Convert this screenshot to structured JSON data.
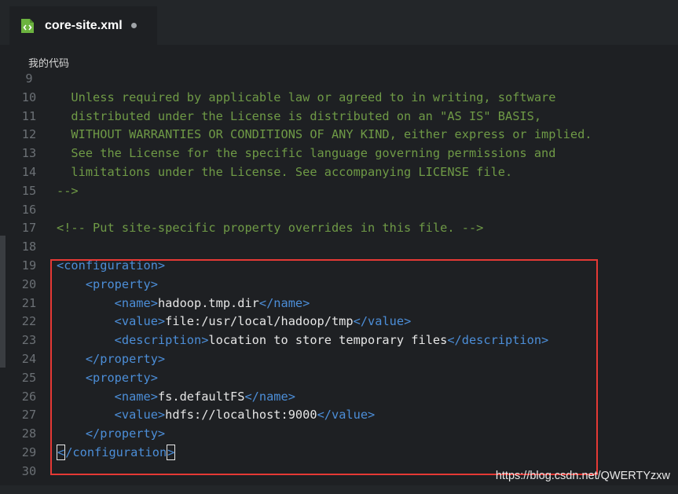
{
  "tab": {
    "filename": "core-site.xml",
    "icon": "xml-file-icon"
  },
  "panel": {
    "title": "我的代码"
  },
  "editor": {
    "lines": [
      {
        "n": "9",
        "segments": []
      },
      {
        "n": "10",
        "segments": [
          {
            "t": "  Unless required by applicable law or agreed to in writing, software",
            "c": "comment"
          }
        ]
      },
      {
        "n": "11",
        "segments": [
          {
            "t": "  distributed under the License is distributed on an \"AS IS\" BASIS,",
            "c": "comment"
          }
        ]
      },
      {
        "n": "12",
        "segments": [
          {
            "t": "  WITHOUT WARRANTIES OR CONDITIONS OF ANY KIND, either express or implied.",
            "c": "comment"
          }
        ]
      },
      {
        "n": "13",
        "segments": [
          {
            "t": "  See the License for the specific language governing permissions and",
            "c": "comment"
          }
        ]
      },
      {
        "n": "14",
        "segments": [
          {
            "t": "  limitations under the License. See accompanying LICENSE file.",
            "c": "comment"
          }
        ]
      },
      {
        "n": "15",
        "segments": [
          {
            "t": "-->",
            "c": "comment"
          }
        ]
      },
      {
        "n": "16",
        "segments": []
      },
      {
        "n": "17",
        "segments": [
          {
            "t": "<!-- Put site-specific property overrides in this file. -->",
            "c": "comment"
          }
        ]
      },
      {
        "n": "18",
        "segments": []
      },
      {
        "n": "19",
        "segments": [
          {
            "t": "<configuration>",
            "c": "tag"
          }
        ]
      },
      {
        "n": "20",
        "segments": [
          {
            "t": "    <property>",
            "c": "tag"
          }
        ]
      },
      {
        "n": "21",
        "segments": [
          {
            "t": "        <name>",
            "c": "tag"
          },
          {
            "t": "hadoop.tmp.dir",
            "c": "text"
          },
          {
            "t": "</name>",
            "c": "tag"
          }
        ]
      },
      {
        "n": "22",
        "segments": [
          {
            "t": "        <value>",
            "c": "tag"
          },
          {
            "t": "file:/usr/local/hadoop/tmp",
            "c": "text"
          },
          {
            "t": "</value>",
            "c": "tag"
          }
        ]
      },
      {
        "n": "23",
        "segments": [
          {
            "t": "        <description>",
            "c": "tag"
          },
          {
            "t": "location to store temporary files",
            "c": "text"
          },
          {
            "t": "</description>",
            "c": "tag"
          }
        ]
      },
      {
        "n": "24",
        "segments": [
          {
            "t": "    </property>",
            "c": "tag"
          }
        ]
      },
      {
        "n": "25",
        "segments": [
          {
            "t": "    <property>",
            "c": "tag"
          }
        ]
      },
      {
        "n": "26",
        "segments": [
          {
            "t": "        <name>",
            "c": "tag"
          },
          {
            "t": "fs.defaultFS",
            "c": "text"
          },
          {
            "t": "</name>",
            "c": "tag"
          }
        ]
      },
      {
        "n": "27",
        "segments": [
          {
            "t": "        <value>",
            "c": "tag"
          },
          {
            "t": "hdfs://localhost:9000",
            "c": "text"
          },
          {
            "t": "</value>",
            "c": "tag"
          }
        ]
      },
      {
        "n": "28",
        "segments": [
          {
            "t": "    </property>",
            "c": "tag"
          }
        ]
      },
      {
        "n": "29",
        "segments": [
          {
            "t": "<",
            "c": "tag-caret"
          },
          {
            "t": "/configuration",
            "c": "tag"
          },
          {
            "t": ">",
            "c": "tag-caret"
          }
        ]
      },
      {
        "n": "30",
        "segments": []
      }
    ]
  },
  "watermark": "https://blog.csdn.net/QWERTYzxw",
  "colors": {
    "comment": "#6f9a46",
    "tag": "#4c8ed8",
    "text": "#e6e6e6",
    "highlight_box": "#e53935",
    "background": "#1e2023"
  }
}
